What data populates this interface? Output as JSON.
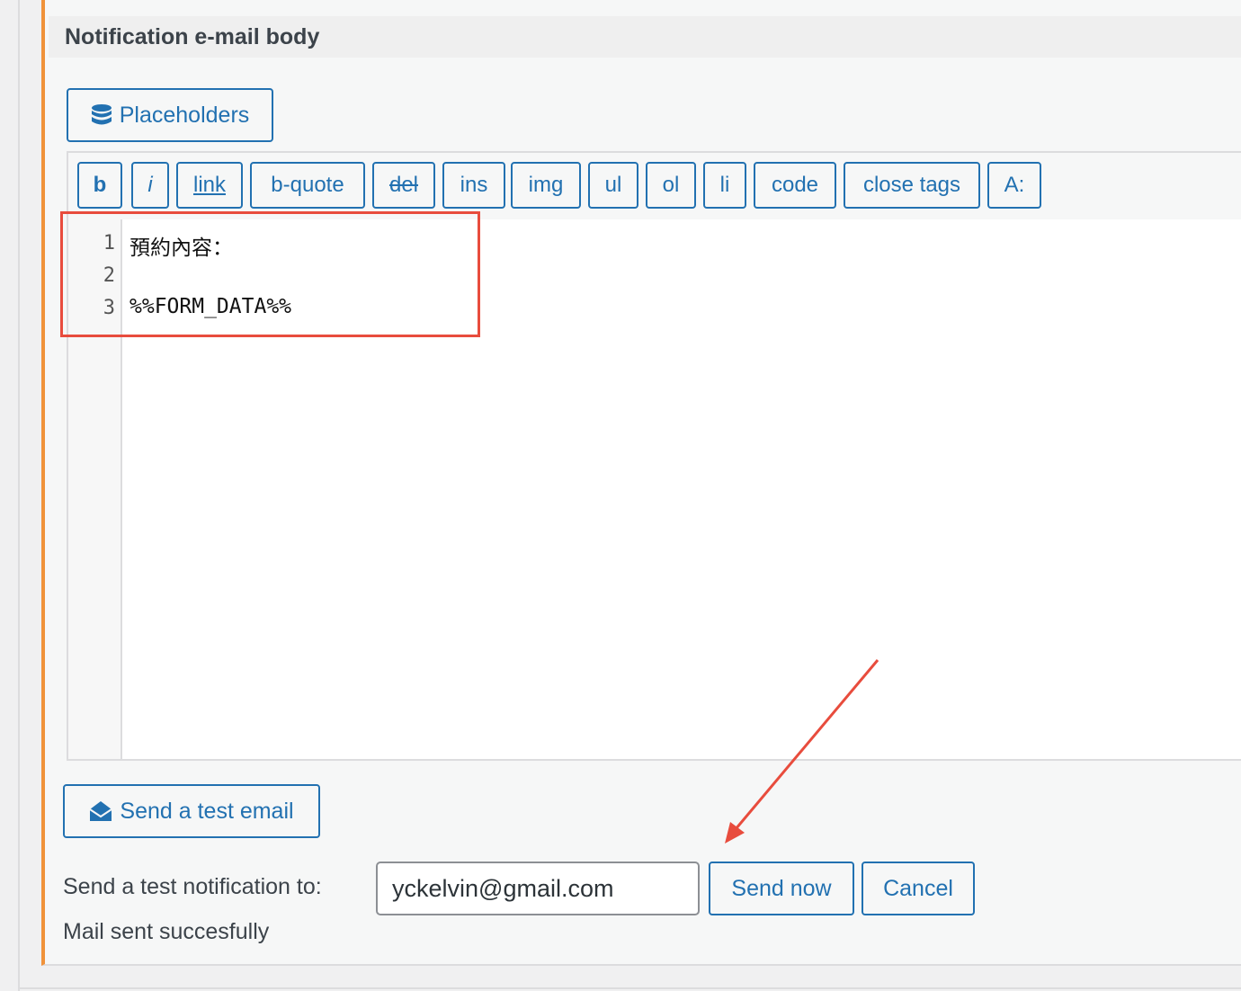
{
  "panel": {
    "title": "Notification e-mail body",
    "placeholders_label": "Placeholders"
  },
  "toolbar": {
    "buttons": [
      "b",
      "i",
      "link",
      "b-quote",
      "del",
      "ins",
      "img",
      "ul",
      "ol",
      "li",
      "code",
      "close tags",
      "A:"
    ]
  },
  "editor": {
    "line_numbers": [
      "1",
      "2",
      "3"
    ],
    "lines": [
      "預約內容：",
      "",
      "%%FORM_DATA%%"
    ]
  },
  "test_email": {
    "button_label": "Send a test email",
    "to_label": "Send a test notification to:",
    "email_value": "yckelvin@gmail.com",
    "send_now_label": "Send now",
    "cancel_label": "Cancel",
    "status": "Mail sent succesfully"
  },
  "colors": {
    "accent": "#2271b1",
    "panel_border": "#f0923a",
    "annotation": "#e84c3d"
  }
}
